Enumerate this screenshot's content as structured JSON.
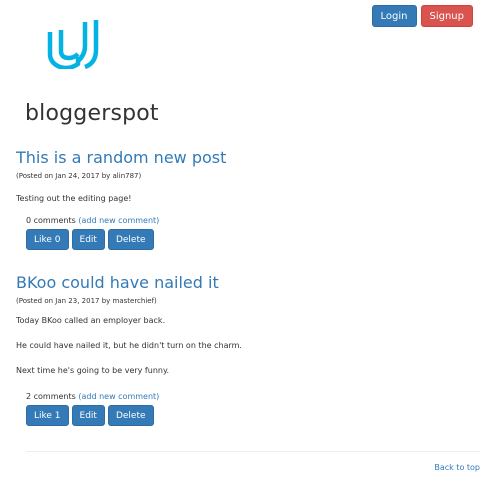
{
  "auth": {
    "login_label": "Login",
    "signup_label": "Signup"
  },
  "logo": {
    "icon": "udacity-logo-icon",
    "color": "#02b3e4"
  },
  "site": {
    "title": "bloggerspot"
  },
  "colors": {
    "primary": "#337ab7",
    "danger": "#d9534f",
    "text": "#333333",
    "link": "#337ab7"
  },
  "posts": [
    {
      "title": "This is a random new post",
      "meta": "(Posted on Jan 24, 2017 by alin787)",
      "paragraphs": [
        "Testing out the editing page!"
      ],
      "comments_count": "0 comments",
      "add_comment": "(add new comment)",
      "like_label": "Like 0",
      "edit_label": "Edit",
      "delete_label": "Delete"
    },
    {
      "title": "BKoo could have nailed it",
      "meta": "(Posted on Jan 23, 2017 by masterchief)",
      "paragraphs": [
        "Today BKoo called an employer back.",
        "He could have nailed it, but he didn't turn on the charm.",
        "Next time he's going to be very funny."
      ],
      "comments_count": "2 comments",
      "add_comment": "(add new comment)",
      "like_label": "Like 1",
      "edit_label": "Edit",
      "delete_label": "Delete"
    }
  ],
  "footer": {
    "back_to_top": "Back to top"
  }
}
